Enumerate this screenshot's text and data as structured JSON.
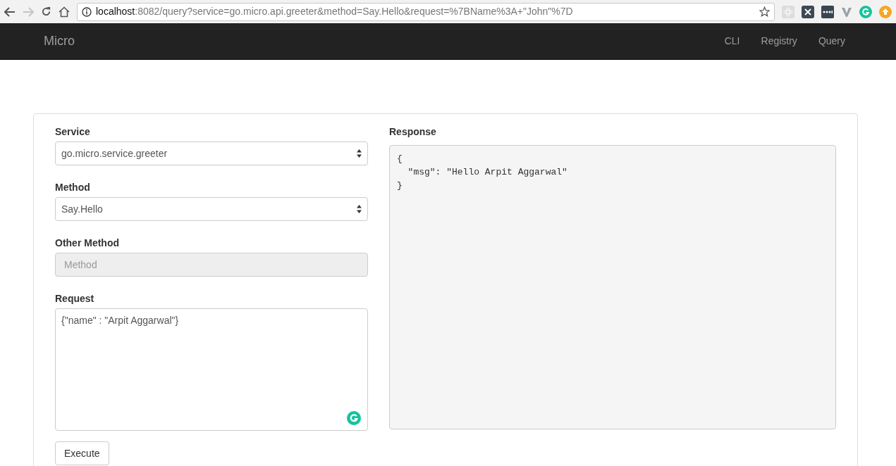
{
  "browser": {
    "back_disabled": false,
    "forward_disabled": true,
    "url_host": "localhost",
    "url_rest": ":8082/query?service=go.micro.api.greeter&method=Say.Hello&request=%7BName%3A+\"John\"%7D"
  },
  "navbar": {
    "brand": "Micro",
    "links": [
      "CLI",
      "Registry",
      "Query"
    ]
  },
  "form": {
    "service": {
      "label": "Service",
      "value": "go.micro.service.greeter"
    },
    "method": {
      "label": "Method",
      "value": "Say.Hello"
    },
    "other_method": {
      "label": "Other Method",
      "placeholder": "Method",
      "disabled": true
    },
    "request": {
      "label": "Request",
      "value": "{\"name\" : \"Arpit Aggarwal\"}"
    },
    "execute": "Execute"
  },
  "response": {
    "label": "Response",
    "body": "{\n  \"msg\": \"Hello Arpit Aggarwal\"\n}"
  }
}
